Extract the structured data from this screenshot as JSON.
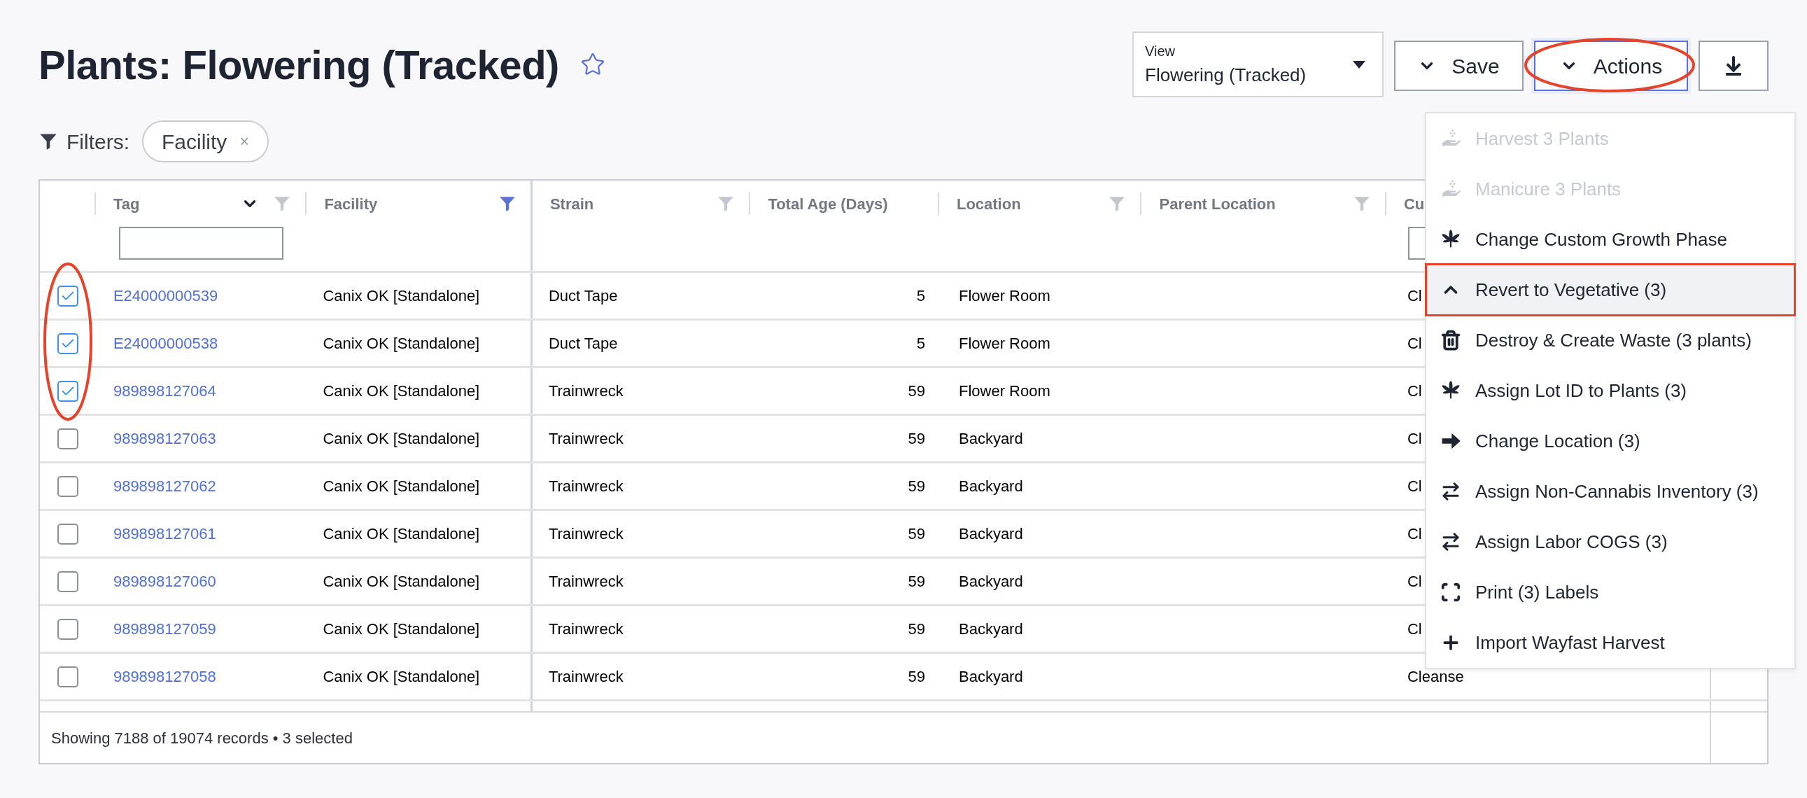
{
  "page": {
    "title": "Plants: Flowering (Tracked)",
    "favorite": false
  },
  "view_select": {
    "label": "View",
    "value": "Flowering (Tracked)"
  },
  "buttons": [
    {
      "label": "Save",
      "kind": "dropdown",
      "selected": false
    },
    {
      "label": "Actions",
      "kind": "dropdown",
      "selected": true
    },
    {
      "kind": "download",
      "selected": false
    }
  ],
  "filters": {
    "label": "Filters:",
    "chips": [
      {
        "label": "Facility",
        "remove": "×"
      }
    ]
  },
  "table": {
    "columns": [
      {
        "kind": "checkbox"
      },
      {
        "kind": "text",
        "label": "Tag",
        "sort": true,
        "filter_active": false,
        "filter_input": true
      },
      {
        "kind": "text",
        "label": "Facility",
        "filter_active": true
      },
      {
        "kind": "text",
        "label": "Strain",
        "filter_active": false
      },
      {
        "kind": "text",
        "label": "Total Age (Days)"
      },
      {
        "kind": "text",
        "label": "Location",
        "filter_active": false
      },
      {
        "kind": "text",
        "label": "Parent Location",
        "filter_active": false
      },
      {
        "kind": "text",
        "label": "Cu",
        "filter_input": true
      },
      {
        "kind": "spacer"
      }
    ],
    "rows": [
      {
        "selected": true,
        "tag": "E24000000539",
        "facility": "Canix OK [Standalone]",
        "strain": "Duct Tape",
        "total_age": "5",
        "location": "Flower Room",
        "column_8": "Cl"
      },
      {
        "selected": true,
        "tag": "E24000000538",
        "facility": "Canix OK [Standalone]",
        "strain": "Duct Tape",
        "total_age": "5",
        "location": "Flower Room",
        "column_8": "Cl"
      },
      {
        "selected": true,
        "tag": "989898127064",
        "facility": "Canix OK [Standalone]",
        "strain": "Trainwreck",
        "total_age": "59",
        "location": "Flower Room",
        "column_8": "Cl"
      },
      {
        "selected": false,
        "tag": "989898127063",
        "facility": "Canix OK [Standalone]",
        "strain": "Trainwreck",
        "total_age": "59",
        "location": "Backyard",
        "column_8": "Cl"
      },
      {
        "selected": false,
        "tag": "989898127062",
        "facility": "Canix OK [Standalone]",
        "strain": "Trainwreck",
        "total_age": "59",
        "location": "Backyard",
        "column_8": "Cl"
      },
      {
        "selected": false,
        "tag": "989898127061",
        "facility": "Canix OK [Standalone]",
        "strain": "Trainwreck",
        "total_age": "59",
        "location": "Backyard",
        "column_8": "Cl"
      },
      {
        "selected": false,
        "tag": "989898127060",
        "facility": "Canix OK [Standalone]",
        "strain": "Trainwreck",
        "total_age": "59",
        "location": "Backyard",
        "column_8": "Cl"
      },
      {
        "selected": false,
        "tag": "989898127059",
        "facility": "Canix OK [Standalone]",
        "strain": "Trainwreck",
        "total_age": "59",
        "location": "Backyard",
        "column_8": "Cl"
      },
      {
        "selected": false,
        "tag": "989898127058",
        "facility": "Canix OK [Standalone]",
        "strain": "Trainwreck",
        "total_age": "59",
        "location": "Backyard",
        "column_8": "Cleanse"
      }
    ],
    "footer": "Showing 7188 of 19074 records • 3 selected"
  },
  "actions_menu": {
    "items": [
      {
        "label": "Harvest 3 Plants",
        "kind": "harvest",
        "disabled": true,
        "selected": false
      },
      {
        "label": "Manicure 3 Plants",
        "kind": "harvest",
        "disabled": true,
        "selected": false
      },
      {
        "label": "Change Custom Growth Phase",
        "kind": "leaf",
        "disabled": false,
        "selected": false
      },
      {
        "label": "Revert to Vegetative (3)",
        "kind": "chevron-up",
        "disabled": false,
        "selected": true
      },
      {
        "label": "Destroy & Create Waste (3 plants)",
        "kind": "trash",
        "disabled": false,
        "selected": false
      },
      {
        "label": "Assign Lot ID to Plants (3)",
        "kind": "leaf",
        "disabled": false,
        "selected": false
      },
      {
        "label": "Change Location (3)",
        "kind": "arrow",
        "disabled": false,
        "selected": false
      },
      {
        "label": "Assign Non-Cannabis Inventory (3)",
        "kind": "swap",
        "disabled": false,
        "selected": false
      },
      {
        "label": "Assign Labor COGS (3)",
        "kind": "swap",
        "disabled": false,
        "selected": false
      },
      {
        "label": "Print (3) Labels",
        "kind": "scan",
        "disabled": false,
        "selected": false
      },
      {
        "label": "Import Wayfast Harvest",
        "kind": "plus",
        "disabled": false,
        "selected": false
      }
    ]
  }
}
